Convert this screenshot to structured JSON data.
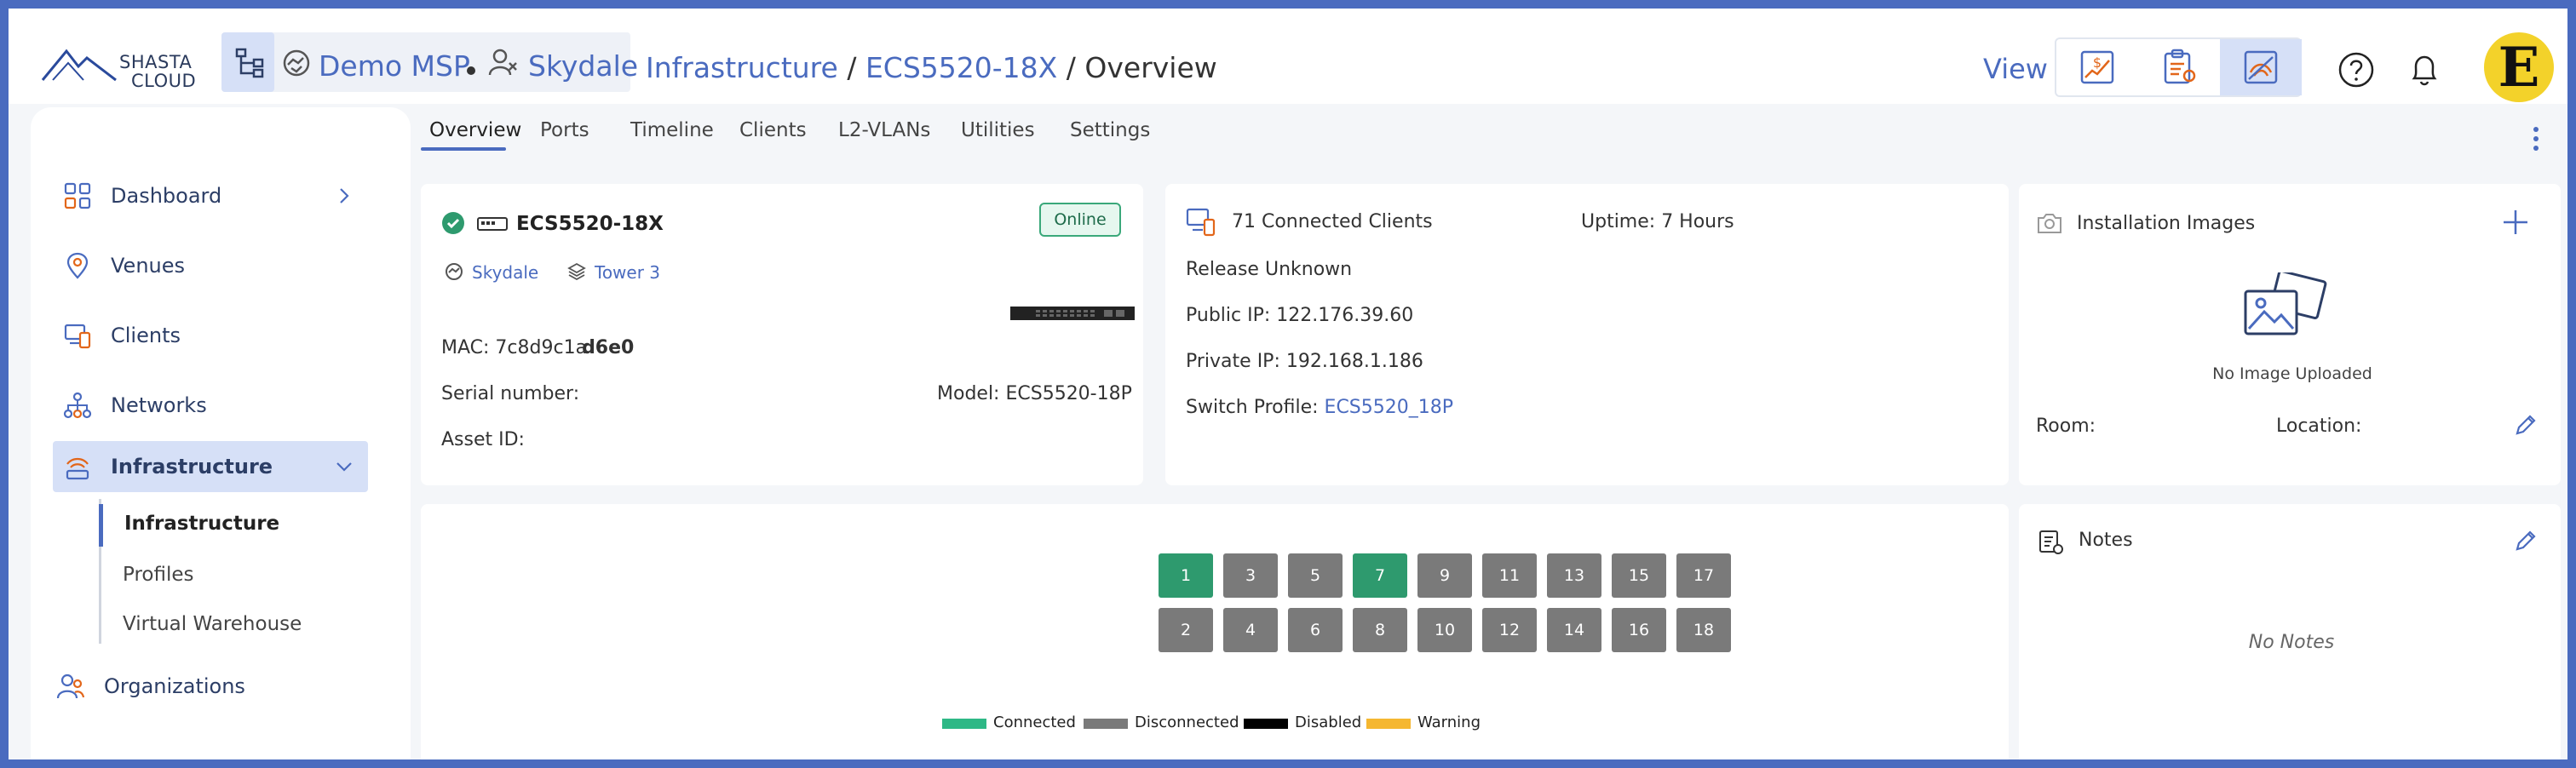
{
  "brand": {
    "line1": "SHASTA",
    "line2": "CLOUD"
  },
  "header": {
    "msp_label": "Demo MSP",
    "org_label": "Skydale",
    "breadcrumb": {
      "section": "Infrastructure",
      "sep1": "/",
      "device": "ECS5520-18X",
      "sep2": "/",
      "page": "Overview"
    },
    "view_label": "View",
    "view_buttons": [
      "billing-chart-icon",
      "report-clipboard-icon",
      "network-analytics-icon"
    ],
    "avatar_letter": "E"
  },
  "sidebar": {
    "items": [
      {
        "label": "Dashboard",
        "icon": "dashboard-icon"
      },
      {
        "label": "Venues",
        "icon": "location-pin-icon"
      },
      {
        "label": "Clients",
        "icon": "clients-icon"
      },
      {
        "label": "Networks",
        "icon": "networks-icon"
      },
      {
        "label": "Infrastructure",
        "icon": "infrastructure-icon"
      },
      {
        "label": "Organizations",
        "icon": "organizations-icon"
      }
    ],
    "subitems": [
      "Infrastructure",
      "Profiles",
      "Virtual Warehouse"
    ]
  },
  "tabs": [
    "Overview",
    "Ports",
    "Timeline",
    "Clients",
    "L2-VLANs",
    "Utilities",
    "Settings"
  ],
  "device": {
    "name": "ECS5520-18X",
    "status": "Online",
    "venue": "Skydale",
    "tower": "Tower 3",
    "mac_label": "MAC:",
    "mac_prefix": "7c8d9c1a",
    "mac_suffix": "d6e0",
    "serial_label": "Serial number:",
    "serial_value": "",
    "model_label": "Model:",
    "model_value": "ECS5520-18P",
    "asset_label": "Asset ID:",
    "asset_value": ""
  },
  "info": {
    "connected_clients": "71 Connected Clients",
    "uptime_label": "Uptime:",
    "uptime_value": "7 Hours",
    "release_label": "Release",
    "release_value": "Unknown",
    "public_ip_label": "Public IP:",
    "public_ip_value": "122.176.39.60",
    "private_ip_label": "Private IP:",
    "private_ip_value": "192.168.1.186",
    "switch_profile_label": "Switch Profile:",
    "switch_profile_value": "ECS5520_18P"
  },
  "images": {
    "title": "Installation Images",
    "empty_text": "No Image Uploaded",
    "room_label": "Room:",
    "location_label": "Location:"
  },
  "notes": {
    "title": "Notes",
    "empty_text": "No Notes"
  },
  "ports": {
    "top": [
      {
        "n": "1",
        "status": "connected"
      },
      {
        "n": "3",
        "status": "disconnected"
      },
      {
        "n": "5",
        "status": "disconnected"
      },
      {
        "n": "7",
        "status": "connected"
      },
      {
        "n": "9",
        "status": "disconnected"
      },
      {
        "n": "11",
        "status": "disconnected"
      },
      {
        "n": "13",
        "status": "disconnected"
      },
      {
        "n": "15",
        "status": "disconnected"
      },
      {
        "n": "17",
        "status": "disconnected"
      }
    ],
    "bottom": [
      {
        "n": "2",
        "status": "disconnected"
      },
      {
        "n": "4",
        "status": "disconnected"
      },
      {
        "n": "6",
        "status": "disconnected"
      },
      {
        "n": "8",
        "status": "disconnected"
      },
      {
        "n": "10",
        "status": "disconnected"
      },
      {
        "n": "12",
        "status": "disconnected"
      },
      {
        "n": "14",
        "status": "disconnected"
      },
      {
        "n": "16",
        "status": "disconnected"
      },
      {
        "n": "18",
        "status": "disconnected"
      }
    ],
    "legend": [
      {
        "label": "Connected",
        "color": "#2eb886"
      },
      {
        "label": "Disconnected",
        "color": "#7a7a7a"
      },
      {
        "label": "Disabled",
        "color": "#000000"
      },
      {
        "label": "Warning",
        "color": "#f5b731"
      }
    ],
    "colors": {
      "connected": "#2e9a6e",
      "disconnected": "#7a7a7a"
    }
  }
}
